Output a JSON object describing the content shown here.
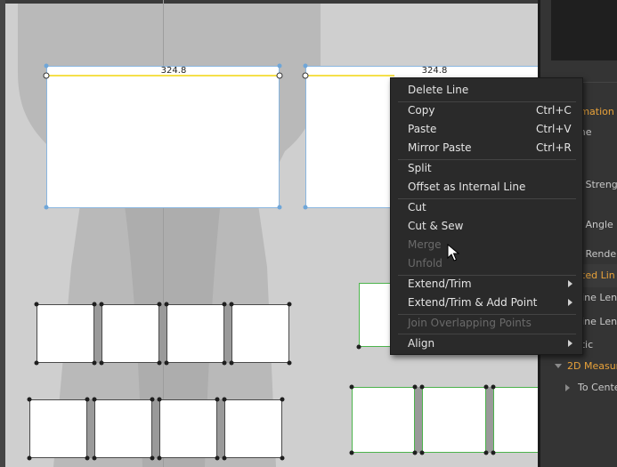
{
  "canvas": {
    "measure_labels": [
      "324.8",
      "324.8"
    ]
  },
  "context_menu": {
    "items": [
      {
        "label": "Delete Line",
        "shortcut": "",
        "disabled": false,
        "submenu": false
      },
      {
        "label": "Copy",
        "shortcut": "Ctrl+C",
        "disabled": false,
        "submenu": false
      },
      {
        "label": "Paste",
        "shortcut": "Ctrl+V",
        "disabled": false,
        "submenu": false
      },
      {
        "label": "Mirror Paste",
        "shortcut": "Ctrl+R",
        "disabled": false,
        "submenu": false
      },
      {
        "label": "Split",
        "shortcut": "",
        "disabled": false,
        "submenu": false
      },
      {
        "label": "Offset as Internal Line",
        "shortcut": "",
        "disabled": false,
        "submenu": false
      },
      {
        "label": "Cut",
        "shortcut": "",
        "disabled": false,
        "submenu": false
      },
      {
        "label": "Cut & Sew",
        "shortcut": "",
        "disabled": false,
        "submenu": false
      },
      {
        "label": "Merge",
        "shortcut": "",
        "disabled": true,
        "submenu": false
      },
      {
        "label": "Unfold",
        "shortcut": "",
        "disabled": true,
        "submenu": false
      },
      {
        "label": "Extend/Trim",
        "shortcut": "",
        "disabled": false,
        "submenu": true
      },
      {
        "label": "Extend/Trim & Add Point",
        "shortcut": "",
        "disabled": false,
        "submenu": true
      },
      {
        "label": "Join Overlapping Points",
        "shortcut": "",
        "disabled": true,
        "submenu": false
      },
      {
        "label": "Align",
        "shortcut": "",
        "disabled": false,
        "submenu": true
      }
    ]
  },
  "property_panel": {
    "rows": [
      "rmation",
      "me",
      "l",
      "d Streng",
      "d Angle",
      "d Rende",
      "cted Lin",
      "Line Len",
      "Line Len",
      "stic",
      "2D Measure",
      "To Cente"
    ]
  },
  "colors": {
    "selection_line": "#f5e04a",
    "selected_pattern_border": "#8ab6e0",
    "green_pattern_border": "#4cb34c",
    "panel_accent": "#e9a23a"
  }
}
